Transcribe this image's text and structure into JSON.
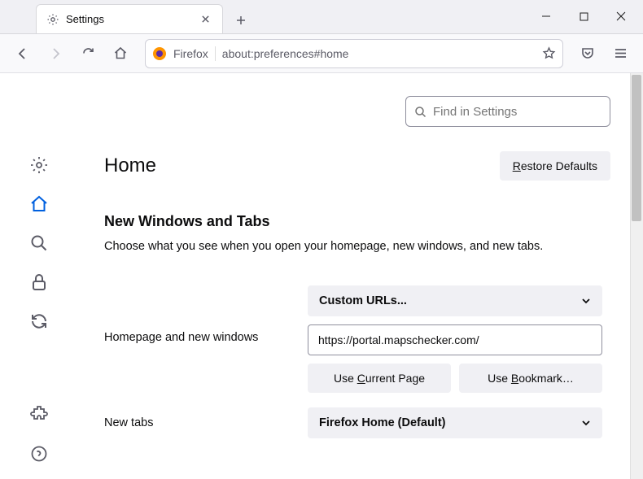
{
  "tab": {
    "title": "Settings"
  },
  "urlbar": {
    "identity": "Firefox",
    "address": "about:preferences#home"
  },
  "search": {
    "placeholder": "Find in Settings"
  },
  "page": {
    "title": "Home",
    "restore_btn": "Restore Defaults",
    "section_title": "New Windows and Tabs",
    "section_desc": "Choose what you see when you open your homepage, new windows, and new tabs."
  },
  "form": {
    "homepage_label": "Homepage and new windows",
    "homepage_dropdown": "Custom URLs...",
    "homepage_url": "https://portal.mapschecker.com/",
    "use_current": "Use Current Page",
    "use_bookmark": "Use Bookmark…",
    "newtabs_label": "New tabs",
    "newtabs_dropdown": "Firefox Home (Default)"
  }
}
